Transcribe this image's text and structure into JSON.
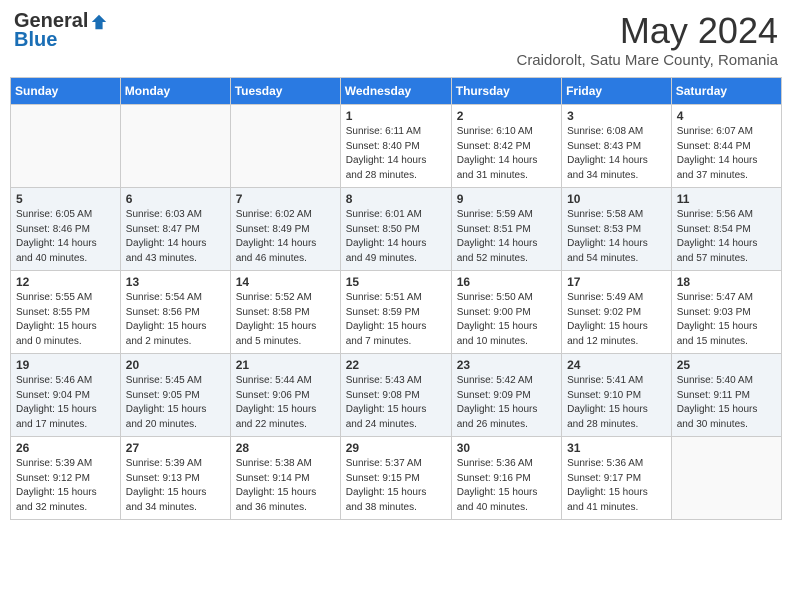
{
  "logo": {
    "general": "General",
    "blue": "Blue"
  },
  "title": "May 2024",
  "location": "Craidorolt, Satu Mare County, Romania",
  "days_of_week": [
    "Sunday",
    "Monday",
    "Tuesday",
    "Wednesday",
    "Thursday",
    "Friday",
    "Saturday"
  ],
  "weeks": [
    [
      {
        "day": "",
        "info": ""
      },
      {
        "day": "",
        "info": ""
      },
      {
        "day": "",
        "info": ""
      },
      {
        "day": "1",
        "info": "Sunrise: 6:11 AM\nSunset: 8:40 PM\nDaylight: 14 hours\nand 28 minutes."
      },
      {
        "day": "2",
        "info": "Sunrise: 6:10 AM\nSunset: 8:42 PM\nDaylight: 14 hours\nand 31 minutes."
      },
      {
        "day": "3",
        "info": "Sunrise: 6:08 AM\nSunset: 8:43 PM\nDaylight: 14 hours\nand 34 minutes."
      },
      {
        "day": "4",
        "info": "Sunrise: 6:07 AM\nSunset: 8:44 PM\nDaylight: 14 hours\nand 37 minutes."
      }
    ],
    [
      {
        "day": "5",
        "info": "Sunrise: 6:05 AM\nSunset: 8:46 PM\nDaylight: 14 hours\nand 40 minutes."
      },
      {
        "day": "6",
        "info": "Sunrise: 6:03 AM\nSunset: 8:47 PM\nDaylight: 14 hours\nand 43 minutes."
      },
      {
        "day": "7",
        "info": "Sunrise: 6:02 AM\nSunset: 8:49 PM\nDaylight: 14 hours\nand 46 minutes."
      },
      {
        "day": "8",
        "info": "Sunrise: 6:01 AM\nSunset: 8:50 PM\nDaylight: 14 hours\nand 49 minutes."
      },
      {
        "day": "9",
        "info": "Sunrise: 5:59 AM\nSunset: 8:51 PM\nDaylight: 14 hours\nand 52 minutes."
      },
      {
        "day": "10",
        "info": "Sunrise: 5:58 AM\nSunset: 8:53 PM\nDaylight: 14 hours\nand 54 minutes."
      },
      {
        "day": "11",
        "info": "Sunrise: 5:56 AM\nSunset: 8:54 PM\nDaylight: 14 hours\nand 57 minutes."
      }
    ],
    [
      {
        "day": "12",
        "info": "Sunrise: 5:55 AM\nSunset: 8:55 PM\nDaylight: 15 hours\nand 0 minutes."
      },
      {
        "day": "13",
        "info": "Sunrise: 5:54 AM\nSunset: 8:56 PM\nDaylight: 15 hours\nand 2 minutes."
      },
      {
        "day": "14",
        "info": "Sunrise: 5:52 AM\nSunset: 8:58 PM\nDaylight: 15 hours\nand 5 minutes."
      },
      {
        "day": "15",
        "info": "Sunrise: 5:51 AM\nSunset: 8:59 PM\nDaylight: 15 hours\nand 7 minutes."
      },
      {
        "day": "16",
        "info": "Sunrise: 5:50 AM\nSunset: 9:00 PM\nDaylight: 15 hours\nand 10 minutes."
      },
      {
        "day": "17",
        "info": "Sunrise: 5:49 AM\nSunset: 9:02 PM\nDaylight: 15 hours\nand 12 minutes."
      },
      {
        "day": "18",
        "info": "Sunrise: 5:47 AM\nSunset: 9:03 PM\nDaylight: 15 hours\nand 15 minutes."
      }
    ],
    [
      {
        "day": "19",
        "info": "Sunrise: 5:46 AM\nSunset: 9:04 PM\nDaylight: 15 hours\nand 17 minutes."
      },
      {
        "day": "20",
        "info": "Sunrise: 5:45 AM\nSunset: 9:05 PM\nDaylight: 15 hours\nand 20 minutes."
      },
      {
        "day": "21",
        "info": "Sunrise: 5:44 AM\nSunset: 9:06 PM\nDaylight: 15 hours\nand 22 minutes."
      },
      {
        "day": "22",
        "info": "Sunrise: 5:43 AM\nSunset: 9:08 PM\nDaylight: 15 hours\nand 24 minutes."
      },
      {
        "day": "23",
        "info": "Sunrise: 5:42 AM\nSunset: 9:09 PM\nDaylight: 15 hours\nand 26 minutes."
      },
      {
        "day": "24",
        "info": "Sunrise: 5:41 AM\nSunset: 9:10 PM\nDaylight: 15 hours\nand 28 minutes."
      },
      {
        "day": "25",
        "info": "Sunrise: 5:40 AM\nSunset: 9:11 PM\nDaylight: 15 hours\nand 30 minutes."
      }
    ],
    [
      {
        "day": "26",
        "info": "Sunrise: 5:39 AM\nSunset: 9:12 PM\nDaylight: 15 hours\nand 32 minutes."
      },
      {
        "day": "27",
        "info": "Sunrise: 5:39 AM\nSunset: 9:13 PM\nDaylight: 15 hours\nand 34 minutes."
      },
      {
        "day": "28",
        "info": "Sunrise: 5:38 AM\nSunset: 9:14 PM\nDaylight: 15 hours\nand 36 minutes."
      },
      {
        "day": "29",
        "info": "Sunrise: 5:37 AM\nSunset: 9:15 PM\nDaylight: 15 hours\nand 38 minutes."
      },
      {
        "day": "30",
        "info": "Sunrise: 5:36 AM\nSunset: 9:16 PM\nDaylight: 15 hours\nand 40 minutes."
      },
      {
        "day": "31",
        "info": "Sunrise: 5:36 AM\nSunset: 9:17 PM\nDaylight: 15 hours\nand 41 minutes."
      },
      {
        "day": "",
        "info": ""
      }
    ]
  ]
}
